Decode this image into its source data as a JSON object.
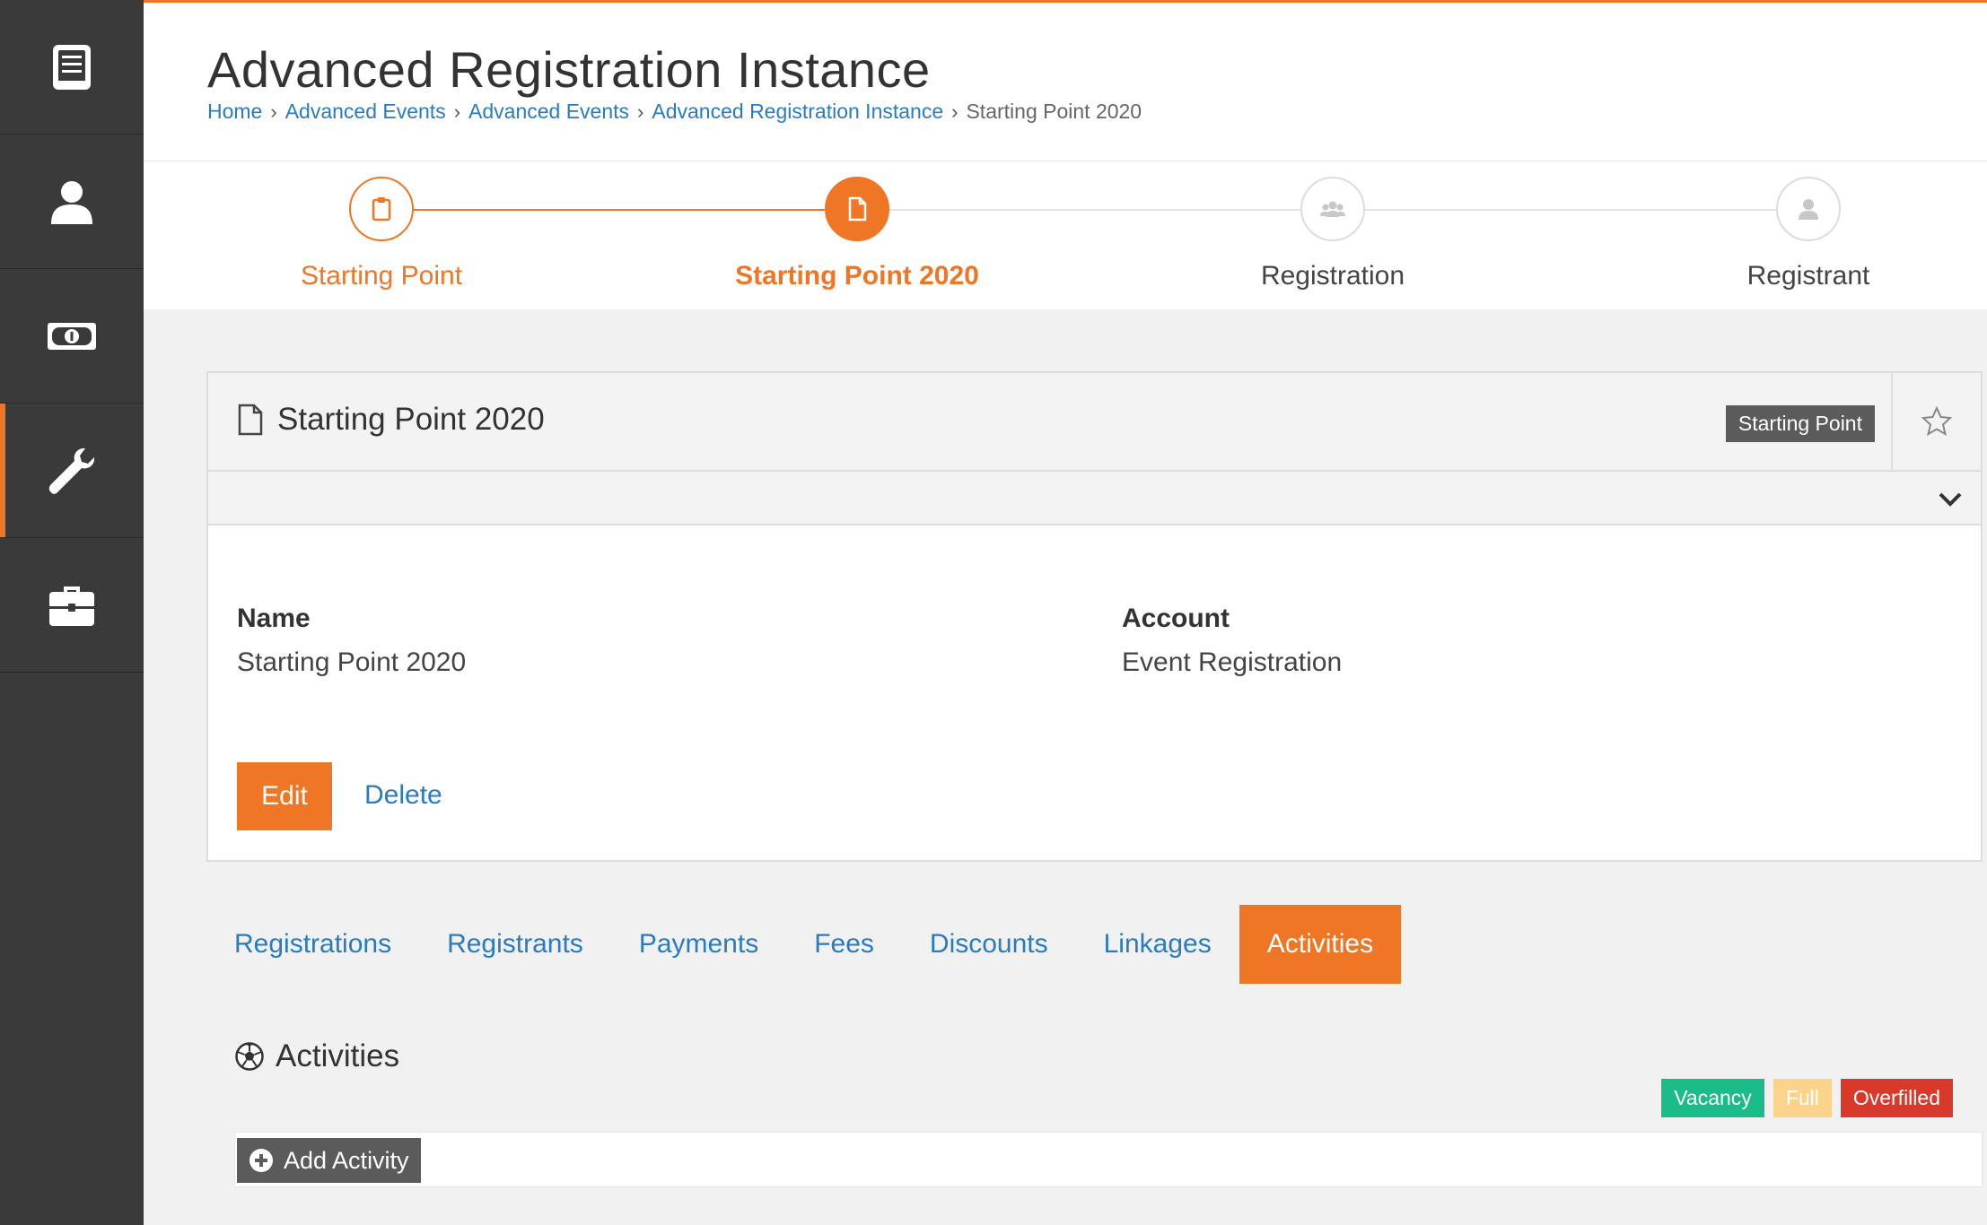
{
  "header": {
    "title": "Advanced Registration Instance",
    "breadcrumb": [
      "Home",
      "Advanced Events",
      "Advanced Events",
      "Advanced Registration Instance"
    ],
    "breadcrumb_current": "Starting Point 2020"
  },
  "sidebar": {
    "items": [
      {
        "icon": "book-icon"
      },
      {
        "icon": "user-icon"
      },
      {
        "icon": "money-icon"
      },
      {
        "icon": "wrench-icon",
        "active": true
      },
      {
        "icon": "briefcase-icon"
      }
    ]
  },
  "stepper": {
    "steps": [
      {
        "label": "Starting Point",
        "state": "done",
        "icon": "clipboard-icon"
      },
      {
        "label": "Starting Point 2020",
        "state": "current",
        "icon": "file-icon"
      },
      {
        "label": "Registration",
        "state": "upcoming",
        "icon": "users-icon"
      },
      {
        "label": "Registrant",
        "state": "upcoming",
        "icon": "user-icon"
      }
    ]
  },
  "panel": {
    "title": "Starting Point 2020",
    "badge": "Starting Point",
    "fields": {
      "name_label": "Name",
      "name_value": "Starting Point 2020",
      "account_label": "Account",
      "account_value": "Event Registration"
    },
    "edit_label": "Edit",
    "delete_label": "Delete"
  },
  "tabs": [
    "Registrations",
    "Registrants",
    "Payments",
    "Fees",
    "Discounts",
    "Linkages",
    "Activities"
  ],
  "active_tab": "Activities",
  "activities": {
    "title": "Activities",
    "legend": [
      {
        "label": "Vacancy",
        "color": "#1bbc8a"
      },
      {
        "label": "Full",
        "color": "#fbd38a"
      },
      {
        "label": "Overfilled",
        "color": "#d9392b"
      }
    ],
    "add_label": "Add Activity"
  },
  "colors": {
    "accent": "#ee7625",
    "link": "#2a7bc2",
    "sidebar": "#3a3a3a"
  }
}
